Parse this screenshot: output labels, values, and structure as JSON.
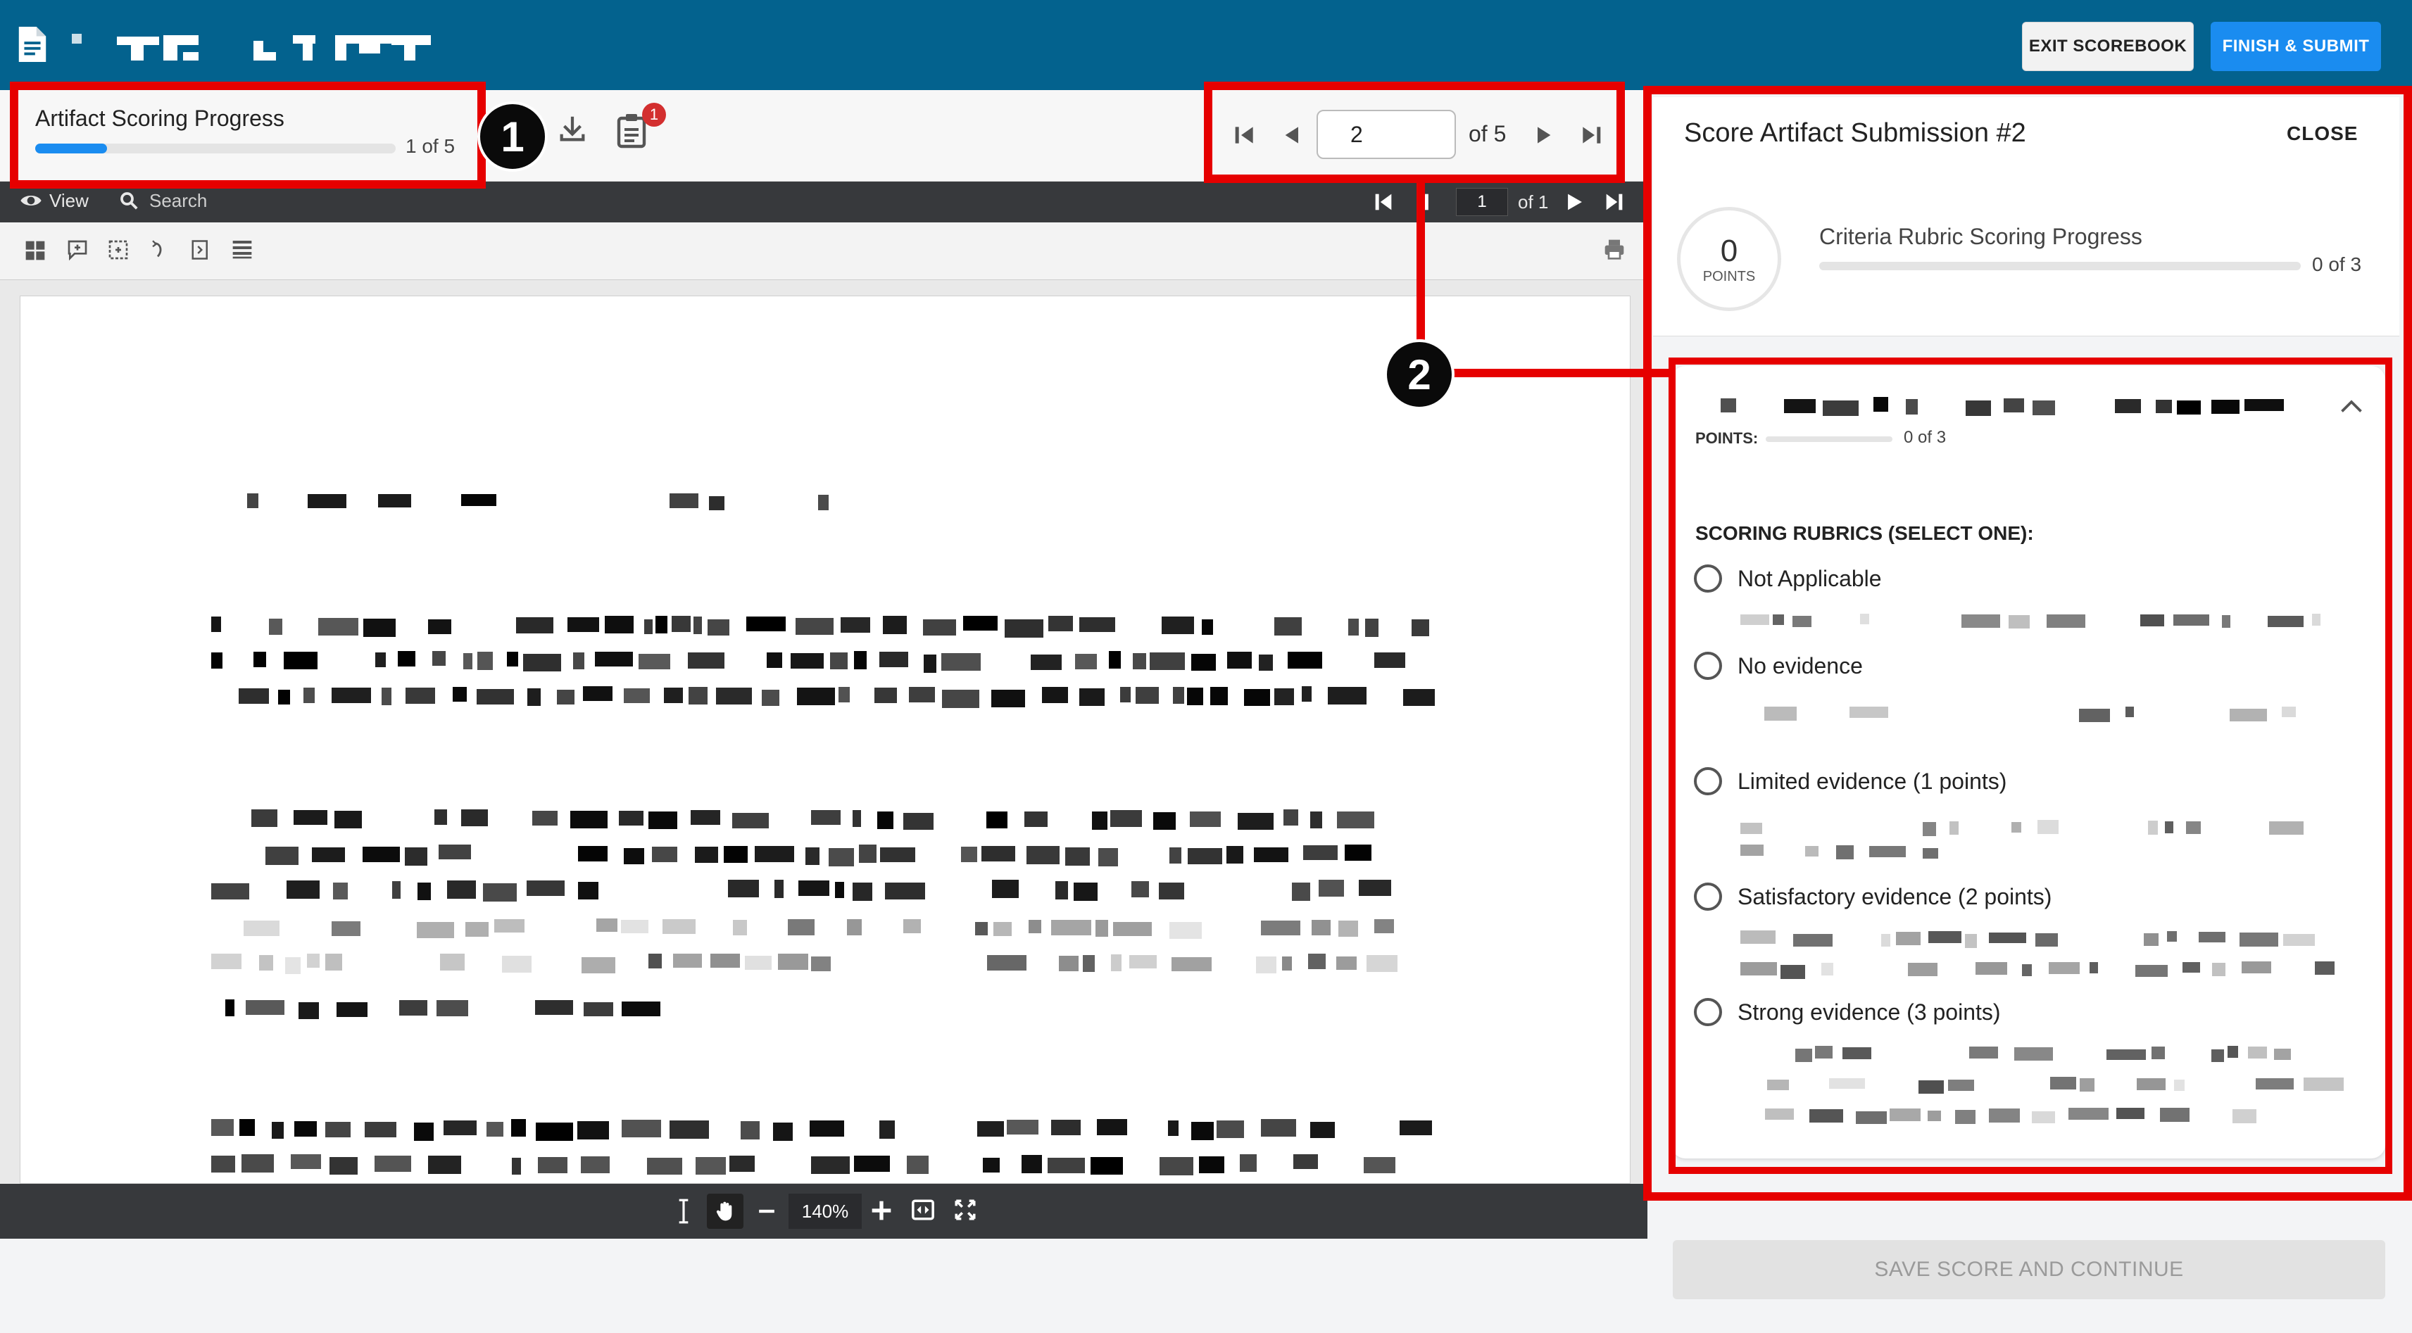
{
  "header": {
    "exit_label": "EXIT SCOREBOOK",
    "finish_label": "FINISH & SUBMIT"
  },
  "progress": {
    "title": "Artifact Scoring Progress",
    "count": "1 of 5",
    "fraction": 0.2,
    "notification_count": "1"
  },
  "pager": {
    "current": "2",
    "of_label": "of 5"
  },
  "viewer": {
    "view_label": "View",
    "search_label": "Search",
    "page_value": "1",
    "page_of": "of 1",
    "zoom": "140%"
  },
  "panel": {
    "title": "Score Artifact Submission #2",
    "close_label": "CLOSE",
    "points_value": "0",
    "points_label": "POINTS",
    "criteria_title": "Criteria Rubric Scoring Progress",
    "criteria_count": "0 of 3",
    "card": {
      "points_label": "POINTS:",
      "points_count": "0 of 3",
      "rubric_heading": "SCORING RUBRICS (SELECT ONE):",
      "options": [
        {
          "label": "Not Applicable"
        },
        {
          "label": "No evidence"
        },
        {
          "label": "Limited evidence (1 points)"
        },
        {
          "label": "Satisfactory evidence (2 points)"
        },
        {
          "label": "Strong evidence (3 points)"
        }
      ]
    },
    "save_label": "SAVE SCORE AND CONTINUE"
  },
  "annotations": {
    "callout_1": "1",
    "callout_2": "2",
    "color": "#e60000"
  },
  "colors": {
    "brand": "#03628e",
    "primary": "#1a8cf0"
  }
}
